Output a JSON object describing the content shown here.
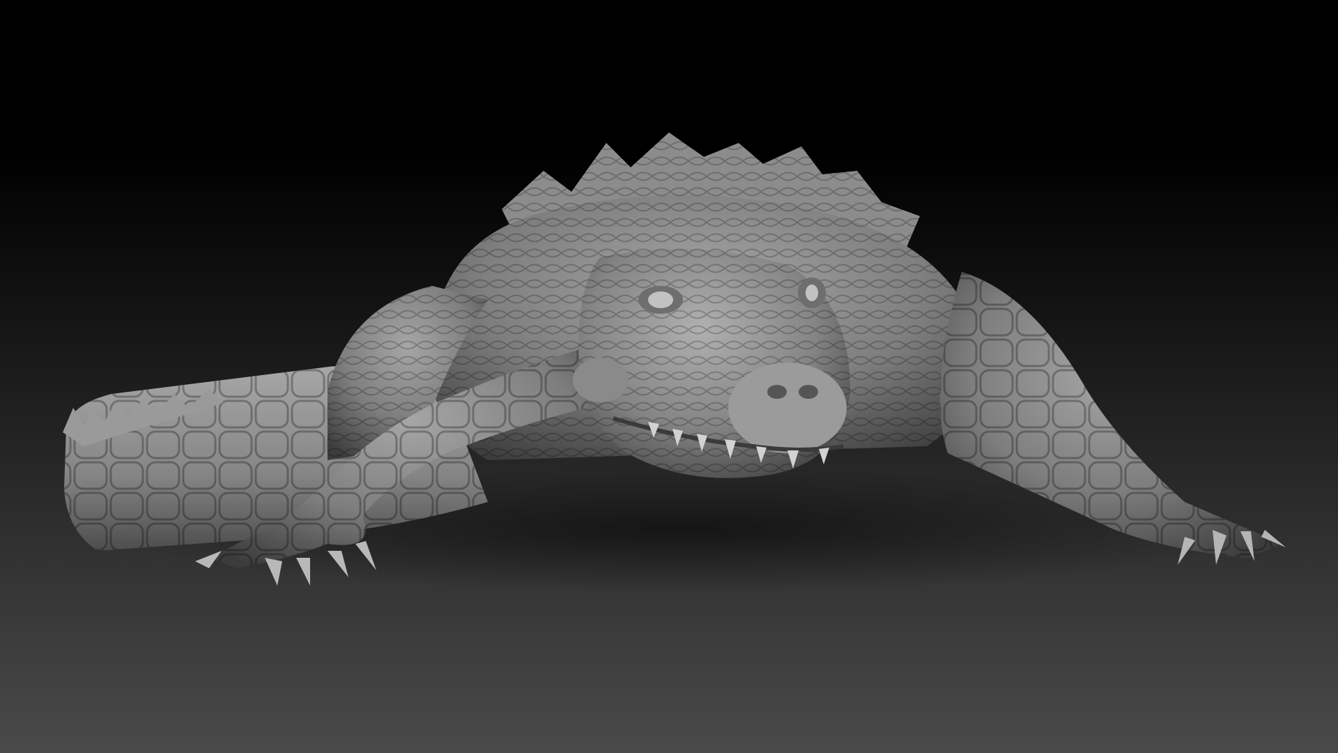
{
  "scene": {
    "background_top_color": "#000000",
    "background_bottom_color": "#4a4a4a",
    "model_color": "#8e8e8e"
  }
}
